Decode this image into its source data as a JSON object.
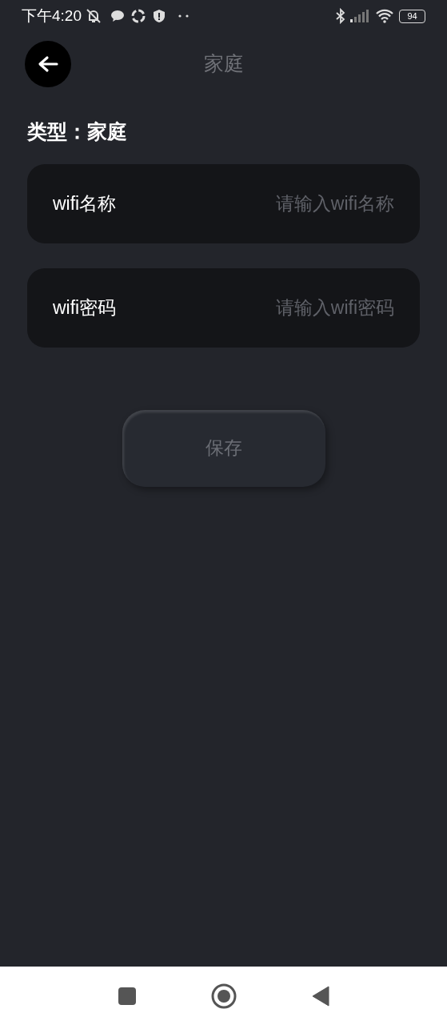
{
  "status_bar": {
    "time": "下午4:20",
    "battery": "94"
  },
  "header": {
    "title": "家庭"
  },
  "type_label": "类型：家庭",
  "fields": [
    {
      "label": "wifi名称",
      "placeholder": "请输入wifi名称"
    },
    {
      "label": "wifi密码",
      "placeholder": "请输入wifi密码"
    }
  ],
  "save_button": "保存"
}
